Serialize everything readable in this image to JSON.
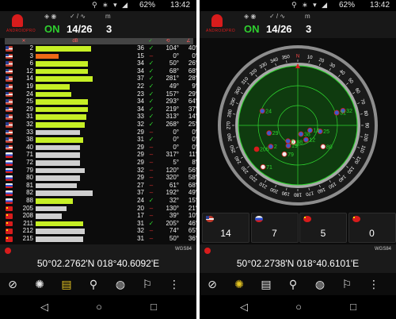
{
  "left": {
    "status": {
      "battery": "62%",
      "time": "13:42"
    },
    "header": {
      "logo_text": "ANDROIDPRO",
      "fix_icons": "◈ ◉",
      "fix_state": "ON",
      "sat_icons": "✓ / ∿",
      "sat_used_total": "14/26",
      "mode_icon": "m",
      "mode_value": "3"
    },
    "columns": {
      "snr": "dB",
      "use": "✓",
      "azimuth": "⟲",
      "elevation": "∠"
    },
    "satellites": [
      {
        "prn": "2",
        "sys": "usa",
        "snr": 36,
        "used": true,
        "azi": "104°",
        "ele": "40°",
        "bar": 0.7,
        "color": "#c6ef25"
      },
      {
        "prn": "3",
        "sys": "usa",
        "snr": 15,
        "used": false,
        "azi": "0°",
        "ele": "0°",
        "bar": 0.29,
        "color": "#ef6a16"
      },
      {
        "prn": "6",
        "sys": "usa",
        "snr": 34,
        "used": true,
        "azi": "50°",
        "ele": "26°",
        "bar": 0.66,
        "color": "#c6ef25"
      },
      {
        "prn": "12",
        "sys": "usa",
        "snr": 34,
        "used": true,
        "azi": "68°",
        "ele": "68°",
        "bar": 0.66,
        "color": "#c6ef25"
      },
      {
        "prn": "14",
        "sys": "usa",
        "snr": 37,
        "used": true,
        "azi": "281°",
        "ele": "28°",
        "bar": 0.72,
        "color": "#c6ef25"
      },
      {
        "prn": "19",
        "sys": "usa",
        "snr": 22,
        "used": true,
        "azi": "49°",
        "ele": "9°",
        "bar": 0.43,
        "color": "#c6ef25"
      },
      {
        "prn": "24",
        "sys": "usa",
        "snr": 23,
        "used": true,
        "azi": "157°",
        "ele": "29°",
        "bar": 0.45,
        "color": "#c6ef25"
      },
      {
        "prn": "25",
        "sys": "usa",
        "snr": 34,
        "used": true,
        "azi": "293°",
        "ele": "64°",
        "bar": 0.66,
        "color": "#c6ef25"
      },
      {
        "prn": "29",
        "sys": "usa",
        "snr": 34,
        "used": true,
        "azi": "219°",
        "ele": "37°",
        "bar": 0.66,
        "color": "#c6ef25"
      },
      {
        "prn": "31",
        "sys": "usa",
        "snr": 33,
        "used": true,
        "azi": "313°",
        "ele": "14°",
        "bar": 0.64,
        "color": "#c6ef25"
      },
      {
        "prn": "32",
        "sys": "usa",
        "snr": 32,
        "used": true,
        "azi": "268°",
        "ele": "25°",
        "bar": 0.62,
        "color": "#c6ef25"
      },
      {
        "prn": "33",
        "sys": "usa",
        "snr": 29,
        "used": false,
        "azi": "0°",
        "ele": "0°",
        "bar": 0.56,
        "color": "#cfcfcf"
      },
      {
        "prn": "38",
        "sys": "usa",
        "snr": 31,
        "used": true,
        "azi": "0°",
        "ele": "0°",
        "bar": 0.6,
        "color": "#c6ef25"
      },
      {
        "prn": "40",
        "sys": "usa",
        "snr": 29,
        "used": false,
        "azi": "0°",
        "ele": "0°",
        "bar": 0.56,
        "color": "#cfcfcf"
      },
      {
        "prn": "71",
        "sys": "rus",
        "snr": 29,
        "used": false,
        "azi": "317°",
        "ele": "11°",
        "bar": 0.56,
        "color": "#cfcfcf"
      },
      {
        "prn": "72",
        "sys": "rus",
        "snr": 29,
        "used": false,
        "azi": "5°",
        "ele": "8°",
        "bar": 0.56,
        "color": "#cfcfcf"
      },
      {
        "prn": "79",
        "sys": "rus",
        "snr": 32,
        "used": false,
        "azi": "120°",
        "ele": "56°",
        "bar": 0.62,
        "color": "#cfcfcf"
      },
      {
        "prn": "80",
        "sys": "rus",
        "snr": 29,
        "used": false,
        "azi": "320°",
        "ele": "58°",
        "bar": 0.56,
        "color": "#cfcfcf"
      },
      {
        "prn": "81",
        "sys": "rus",
        "snr": 27,
        "used": false,
        "azi": "61°",
        "ele": "68°",
        "bar": 0.52,
        "color": "#cfcfcf"
      },
      {
        "prn": "82",
        "sys": "rus",
        "snr": 37,
        "used": false,
        "azi": "192°",
        "ele": "49°",
        "bar": 0.72,
        "color": "#cfcfcf"
      },
      {
        "prn": "88",
        "sys": "rus",
        "snr": 24,
        "used": true,
        "azi": "32°",
        "ele": "15°",
        "bar": 0.47,
        "color": "#c6ef25"
      },
      {
        "prn": "205",
        "sys": "chn",
        "snr": 20,
        "used": false,
        "azi": "130°",
        "ele": "21°",
        "bar": 0.39,
        "color": "#cfcfcf"
      },
      {
        "prn": "208",
        "sys": "chn",
        "snr": 17,
        "used": false,
        "azi": "39°",
        "ele": "10°",
        "bar": 0.33,
        "color": "#cfcfcf"
      },
      {
        "prn": "211",
        "sys": "chn",
        "snr": 31,
        "used": true,
        "azi": "205°",
        "ele": "46°",
        "bar": 0.6,
        "color": "#c6ef25"
      },
      {
        "prn": "212",
        "sys": "chn",
        "snr": 32,
        "used": false,
        "azi": "74°",
        "ele": "65°",
        "bar": 0.62,
        "color": "#cfcfcf"
      },
      {
        "prn": "215",
        "sys": "chn",
        "snr": 31,
        "used": false,
        "azi": "50°",
        "ele": "36°",
        "bar": 0.6,
        "color": "#cfcfcf"
      }
    ],
    "location": {
      "datum": "WGS84",
      "coords": "50°02.2762'N  018°40.6092'E"
    }
  },
  "right": {
    "status": {
      "battery": "62%",
      "time": "13:42"
    },
    "header": {
      "logo_text": "ANDROIDPRO",
      "fix_icons": "◈ ◉",
      "fix_state": "ON",
      "sat_icons": "✓ / ∿",
      "sat_used_total": "14/26",
      "mode_icon": "m",
      "mode_value": "3"
    },
    "compass": {
      "ticks": [
        "N",
        "10",
        "20",
        "30",
        "40",
        "50",
        "60",
        "70",
        "80",
        "90",
        "100",
        "110",
        "120",
        "130",
        "140",
        "150",
        "160",
        "170",
        "180",
        "190",
        "200",
        "210",
        "220",
        "230",
        "240",
        "250",
        "260",
        "270",
        "280",
        "290",
        "300",
        "310",
        "320",
        "330",
        "340",
        "350"
      ],
      "satellites": [
        {
          "label": "24",
          "az": 292,
          "el": 32,
          "sys": "usa"
        },
        {
          "label": "205",
          "az": 240,
          "el": 18,
          "sys": "chn"
        },
        {
          "label": "79",
          "az": 205,
          "el": 42,
          "sys": "rus"
        },
        {
          "label": "19",
          "az": 205,
          "el": 56,
          "sys": "usa"
        },
        {
          "label": "32",
          "az": 72,
          "el": 18,
          "sys": "usa"
        },
        {
          "label": "25",
          "az": 105,
          "el": 55,
          "sys": "usa"
        },
        {
          "label": "14",
          "az": 112,
          "el": 70,
          "sys": "usa"
        },
        {
          "label": "80",
          "az": 130,
          "el": 40,
          "sys": "rus"
        },
        {
          "label": "31",
          "az": 72,
          "el": 28,
          "sys": "usa"
        },
        {
          "label": "12",
          "az": 150,
          "el": 65,
          "sys": "usa"
        },
        {
          "label": "38",
          "az": 160,
          "el": 76,
          "sys": "usa"
        },
        {
          "label": "88",
          "az": 195,
          "el": 64,
          "sys": "rus"
        },
        {
          "label": "71",
          "az": 220,
          "el": 8,
          "sys": "rus"
        },
        {
          "label": "29",
          "az": 255,
          "el": 45,
          "sys": "usa"
        },
        {
          "label": "6",
          "az": 212,
          "el": 62,
          "sys": "usa"
        },
        {
          "label": "2",
          "az": 232,
          "el": 38,
          "sys": "usa"
        }
      ],
      "counts": [
        {
          "sys": "usa",
          "value": "14"
        },
        {
          "sys": "rus",
          "value": "7"
        },
        {
          "sys": "chn",
          "value": "5"
        },
        {
          "sys": "gal",
          "value": "0"
        }
      ]
    },
    "location": {
      "datum": "WGS84",
      "coords": "50°02.2738'N  018°40.6101'E"
    }
  },
  "nav_icons": [
    "compass-icon",
    "radar-icon",
    "signal-bars-icon",
    "walk-icon",
    "globe-icon",
    "map-pin-icon",
    "more-icon"
  ],
  "sys_icons": [
    "back-icon",
    "home-icon",
    "recents-icon"
  ],
  "colors": {
    "green": "#2fcf2f",
    "red": "#e03030",
    "lime": "#c6ef25",
    "orange": "#ef6a16",
    "accent_yellow": "#e3c321"
  }
}
